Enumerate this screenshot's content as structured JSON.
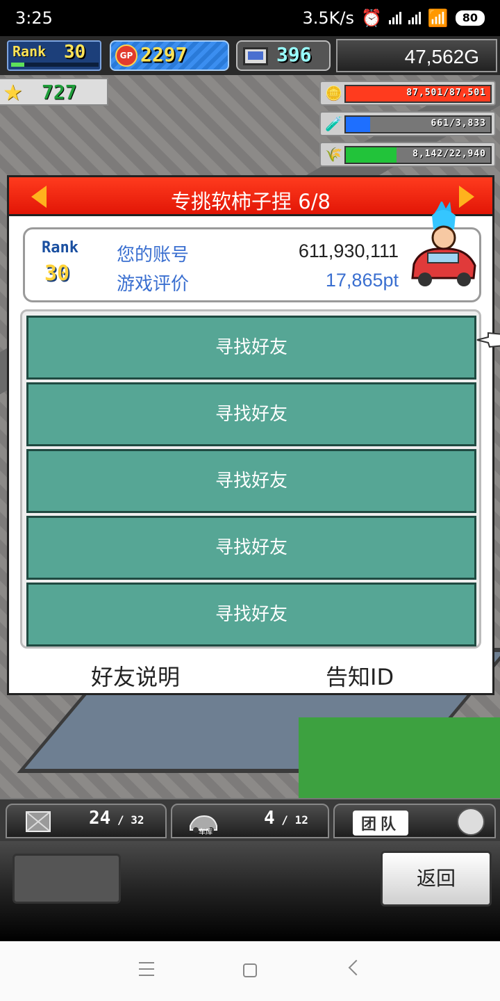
{
  "status_bar": {
    "time": "3:25",
    "network_speed": "3.5K/s",
    "battery": "80"
  },
  "hud": {
    "rank_label": "Rank",
    "rank_value": "30",
    "rank_progress": 0.15,
    "gp_icon_label": "GP",
    "gp_value": "2297",
    "pc_value": "396",
    "money": "47,562G",
    "stars": "727"
  },
  "resources": [
    {
      "icon": "coin-stack-icon",
      "value": "87,501/87,501",
      "fill_fraction": 1.0,
      "color": "#ff3b1e"
    },
    {
      "icon": "fuel-tank-icon",
      "value": "661/3,833",
      "fill_fraction": 0.17,
      "color": "#1e6fff"
    },
    {
      "icon": "wheat-icon",
      "value": "8,142/22,940",
      "fill_fraction": 0.35,
      "color": "#22c33a"
    }
  ],
  "dialog": {
    "title": "专挑软柿子捏 6/8",
    "account": {
      "rank_label": "Rank",
      "rank_value": "30",
      "account_label": "您的账号",
      "account_value": "611,930,111",
      "rating_label": "游戏评价",
      "rating_value": "17,865pt"
    },
    "friend_slots": [
      {
        "label": "寻找好友"
      },
      {
        "label": "寻找好友"
      },
      {
        "label": "寻找好友"
      },
      {
        "label": "寻找好友"
      },
      {
        "label": "寻找好友"
      }
    ],
    "footer": {
      "help_label": "好友说明",
      "notify_label": "告知ID"
    }
  },
  "bottom_tabs": {
    "storage_count": "24",
    "storage_max": "32",
    "garage_label": "车库",
    "garage_count": "4",
    "garage_max": "12",
    "team_label": "团队"
  },
  "bottom_panel": {
    "back_label": "返回"
  },
  "colors": {
    "header_red": "#e21606",
    "friend_button": "#56a695",
    "accent_blue": "#3a6fd0"
  }
}
